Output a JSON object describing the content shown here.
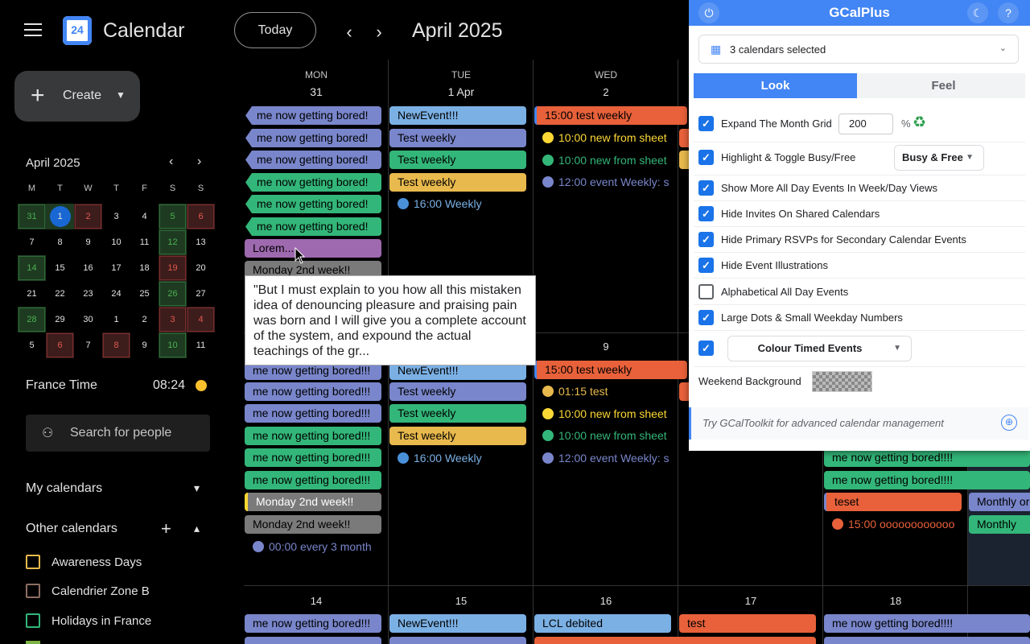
{
  "topbar": {
    "app_title": "Calendar",
    "logo_number": "24",
    "today_label": "Today",
    "prev_icon": "chevron-left-icon",
    "next_icon": "chevron-right-icon",
    "month_title": "April 2025"
  },
  "sidebar": {
    "create_label": "Create",
    "mini_cal": {
      "title": "April 2025",
      "weekdays": [
        "M",
        "T",
        "W",
        "T",
        "F",
        "S",
        "S"
      ],
      "weeks": [
        [
          "31",
          "1",
          "2",
          "3",
          "4",
          "5",
          "6"
        ],
        [
          "7",
          "8",
          "9",
          "10",
          "11",
          "12",
          "13"
        ],
        [
          "14",
          "15",
          "16",
          "17",
          "18",
          "19",
          "20"
        ],
        [
          "21",
          "22",
          "23",
          "24",
          "25",
          "26",
          "27"
        ],
        [
          "28",
          "29",
          "30",
          "1",
          "2",
          "3",
          "4"
        ],
        [
          "5",
          "6",
          "7",
          "8",
          "9",
          "10",
          "11"
        ]
      ]
    },
    "timezone_label": "France Time",
    "timezone_time": "08:24",
    "search_people_placeholder": "Search for people",
    "my_calendars": "My calendars",
    "other_calendars": "Other calendars",
    "calendars": [
      {
        "name": "Awareness Days",
        "color": "#e8b94d"
      },
      {
        "name": "Calendrier Zone B",
        "color": "#8d6e63"
      },
      {
        "name": "Holidays in France",
        "color": "#33b679"
      }
    ]
  },
  "grid": {
    "headers": [
      {
        "day": "MON",
        "date": "31"
      },
      {
        "day": "TUE",
        "date": "1 Apr"
      },
      {
        "day": "WED",
        "date": "2"
      }
    ],
    "week1": {
      "mon": [
        "me now getting bored!",
        "me now getting bored!",
        "me now getting bored!",
        "me now getting bored!",
        "me now getting bored!",
        "me now getting bored!",
        "Lorem...",
        "Monday 2nd week!!"
      ],
      "tue": [
        "NewEvent!!!",
        "Test weekly",
        "Test weekly",
        "Test weekly"
      ],
      "tue_dot": {
        "time": "16:00",
        "title": "Weekly"
      },
      "wed_chip": "15:00 test weekly",
      "wed_dots": [
        {
          "time": "10:00",
          "title": "new from sheet"
        },
        {
          "time": "10:00",
          "title": "new from sheet"
        },
        {
          "time": "12:00",
          "title": "event Weekly: s"
        }
      ]
    },
    "tooltip": "\"But I must explain to you how all this mistaken idea of denouncing pleasure and praising pain was born and I will give you a complete account of the system, and expound the actual teachings of the gr...",
    "week2": {
      "wed_date": "9",
      "mon": [
        "me now getting bored!!!",
        "me now getting bored!!!",
        "me now getting bored!!!",
        "me now getting bored!!!",
        "me now getting bored!!!",
        "me now getting bored!!!",
        "Monday 2nd week!!",
        "Monday 2nd week!!"
      ],
      "mon_dot": {
        "time": "00:00",
        "title": "every 3 month"
      },
      "tue": [
        "NewEvent!!!",
        "Test weekly",
        "Test weekly",
        "Test weekly"
      ],
      "tue_dot": {
        "time": "16:00",
        "title": "Weekly"
      },
      "wed_chip": "15:00 test weekly",
      "wed_dots": [
        {
          "time": "01:15",
          "title": "test"
        },
        {
          "time": "10:00",
          "title": "new from sheet"
        },
        {
          "time": "10:00",
          "title": "new from sheet"
        },
        {
          "time": "12:00",
          "title": "event Weekly: s"
        }
      ],
      "fri_chips": [
        "me now getting bored!!!!",
        "me now getting bored!!!!",
        "teset"
      ],
      "fri_dot": {
        "time": "15:00",
        "title": "oooooooooooo"
      },
      "sat_chips": [
        "Monthly or",
        "Monthly"
      ]
    },
    "week3": {
      "dates": [
        "14",
        "15",
        "16",
        "17",
        "18"
      ],
      "chips": [
        "me now getting bored!!!",
        "NewEvent!!!",
        "LCL debited",
        "test",
        "me now getting bored!!!!"
      ]
    }
  },
  "panel": {
    "title": "GCalPlus",
    "calendars_selected": "3 calendars selected",
    "tabs": [
      "Look",
      "Feel"
    ],
    "options": {
      "expand": "Expand The Month Grid",
      "expand_value": "200",
      "expand_unit": "%",
      "highlight": "Highlight & Toggle Busy/Free",
      "highlight_value": "Busy & Free",
      "show_more": "Show More All Day Events In Week/Day Views",
      "hide_invites": "Hide Invites On Shared Calendars",
      "hide_rsvps": "Hide Primary RSVPs for Secondary Calendar Events",
      "hide_illustrations": "Hide Event Illustrations",
      "alphabetical": "Alphabetical All Day Events",
      "large_dots": "Large Dots & Small Weekday Numbers",
      "colour_timed": "Colour Timed Events",
      "weekend_bg": "Weekend Background"
    },
    "promo": "Try GCalToolkit for advanced calendar management"
  }
}
